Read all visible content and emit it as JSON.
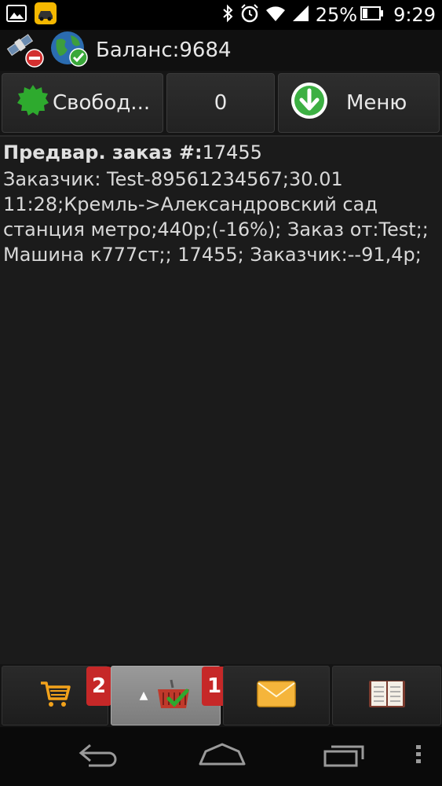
{
  "status_bar": {
    "left_icons": [
      "image-icon",
      "taxi-app-icon"
    ],
    "right_icons": [
      "bluetooth-icon",
      "alarm-icon",
      "wifi-icon",
      "signal-icon",
      "battery-icon"
    ],
    "battery_percent": "25%",
    "time": "9:29"
  },
  "header": {
    "icons": [
      "satellite-off-icon",
      "globe-ok-icon"
    ],
    "balance": "Баланс:9684"
  },
  "toolbar": {
    "status_label": "Свобод...",
    "counter": "0",
    "menu_label": "Меню"
  },
  "order": {
    "title_bold": "Предвар. заказ #:",
    "number": "17455",
    "details": "Заказчик: Test-89561234567;30.01 11:28;Кремль->Александровский сад станция метро;440р;(-16%); Заказ от:Test;; Машина к777ст;; 17455; Заказчик:--91,4р;"
  },
  "bottom_tabs": [
    {
      "icon": "cart-icon",
      "badge": "2"
    },
    {
      "icon": "basket-check-icon",
      "badge": "1",
      "active": true
    },
    {
      "icon": "envelope-icon"
    },
    {
      "icon": "book-icon"
    }
  ],
  "colors": {
    "background": "#1b1b1b",
    "badge": "#c62828",
    "status_green": "#2eaa2e",
    "menu_green": "#3cb043"
  }
}
